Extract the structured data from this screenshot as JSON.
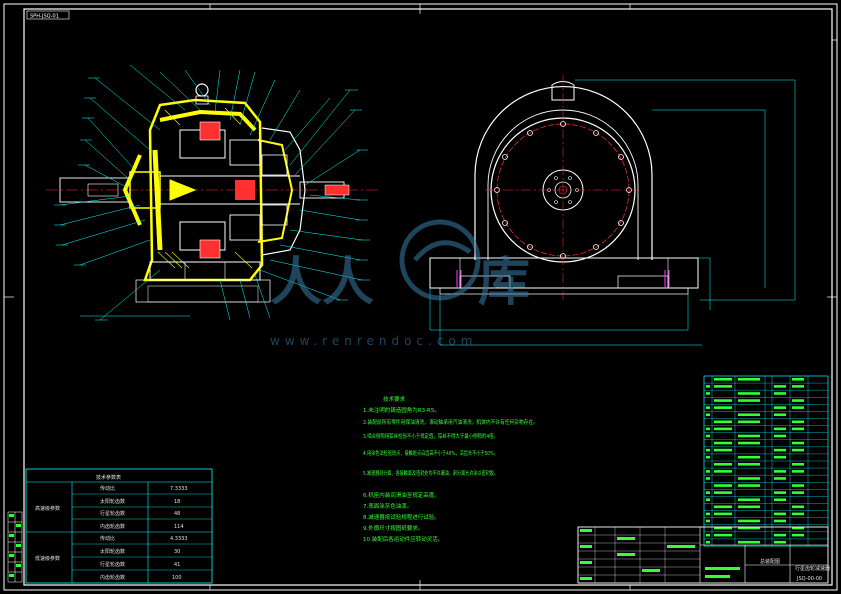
{
  "drawing": {
    "corner_tag": "SPH-JSQ-01",
    "watermark_url": "www.renrendoc.com"
  },
  "tech_notes": {
    "title": "技术要求",
    "lines": [
      "1.未注明的铸造圆角为R3-R5。",
      "2.装配前所有零件用煤油清洗，滚动轴承用汽油清洗，机体内不许有任何杂物存在。",
      "3.啮合侧隙用铅丝检验不小于规定值，铅丝不得大于最小侧隙的4倍。",
      "4.用涂色法检验斑点，接触斑点沿齿高不小于40%，沿齿长不小于50%。",
      "5.减速器剖分面、各接触面及密封处均不许漏油，剖分面允许涂以密封胶。",
      "6.机座内装润滑油至规定高度。",
      "7.表面涂灰色油漆。",
      "8.减速器按试验规程进行试验。",
      "9.外廓尺寸按图纸要求。",
      "10.装配后各运动件应转动灵活。"
    ]
  },
  "param_table": {
    "title": "技术参数表",
    "group1": {
      "name": "高速级参数",
      "rows": [
        {
          "label": "传动比",
          "value": "7.3333"
        },
        {
          "label": "太阳轮齿数",
          "value": "18"
        },
        {
          "label": "行星轮齿数",
          "value": "48"
        },
        {
          "label": "内齿轮齿数",
          "value": "114"
        }
      ]
    },
    "group2": {
      "name": "低速级参数",
      "rows": [
        {
          "label": "传动比",
          "value": "4.3333"
        },
        {
          "label": "太阳轮齿数",
          "value": "30"
        },
        {
          "label": "行星轮齿数",
          "value": "41"
        },
        {
          "label": "内齿轮齿数",
          "value": "100"
        }
      ]
    }
  },
  "title_block": {
    "drawing_title": "总装配图",
    "drawing_number": "JSQ-00-00",
    "name_cell": "行星齿轮减速器"
  },
  "colors": {
    "border": "#ffffff",
    "part_yellow": "#ffff00",
    "leader_cyan": "#00ffff",
    "accent_red": "#ff2020",
    "note_green": "#33ff33",
    "watermark_blue": "#3a7fa8"
  }
}
